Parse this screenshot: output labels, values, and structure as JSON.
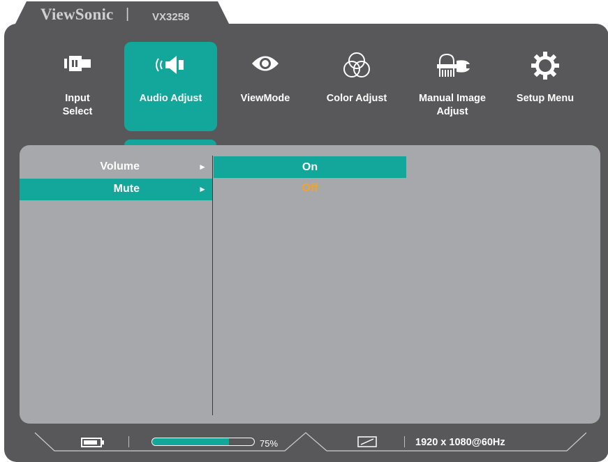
{
  "header": {
    "brand": "ViewSonic",
    "separator": "|",
    "model": "VX3258"
  },
  "menu": [
    {
      "id": "input-select",
      "label": "Input\nSelect",
      "icon": "input-source-icon",
      "active": false
    },
    {
      "id": "audio-adjust",
      "label": "Audio Adjust",
      "icon": "speaker-icon",
      "active": true
    },
    {
      "id": "viewmode",
      "label": "ViewMode",
      "icon": "eye-icon",
      "active": false
    },
    {
      "id": "color-adjust",
      "label": "Color Adjust",
      "icon": "color-circles-icon",
      "active": false
    },
    {
      "id": "manual-image-adjust",
      "label": "Manual Image\nAdjust",
      "icon": "hand-wrench-icon",
      "active": false
    },
    {
      "id": "setup-menu",
      "label": "Setup Menu",
      "icon": "gear-icon",
      "active": false
    }
  ],
  "submenu": {
    "items": [
      {
        "label": "Volume",
        "arrow": "►",
        "selected": false
      },
      {
        "label": "Mute",
        "arrow": "►",
        "selected": true
      }
    ],
    "options": [
      {
        "label": "On",
        "selected": true,
        "current": false
      },
      {
        "label": "Off",
        "selected": false,
        "current": true
      }
    ]
  },
  "status_bar": {
    "battery_icon": "battery-icon",
    "progress_value": 0.75,
    "progress_label": "75%",
    "aspect_icon": "aspect-ratio-icon",
    "resolution": "1920 x 1080@60Hz"
  },
  "colors": {
    "accent": "#13a69b",
    "frame": "#58585a",
    "panel": "#a7a8ab",
    "current_value": "#f3a329"
  }
}
